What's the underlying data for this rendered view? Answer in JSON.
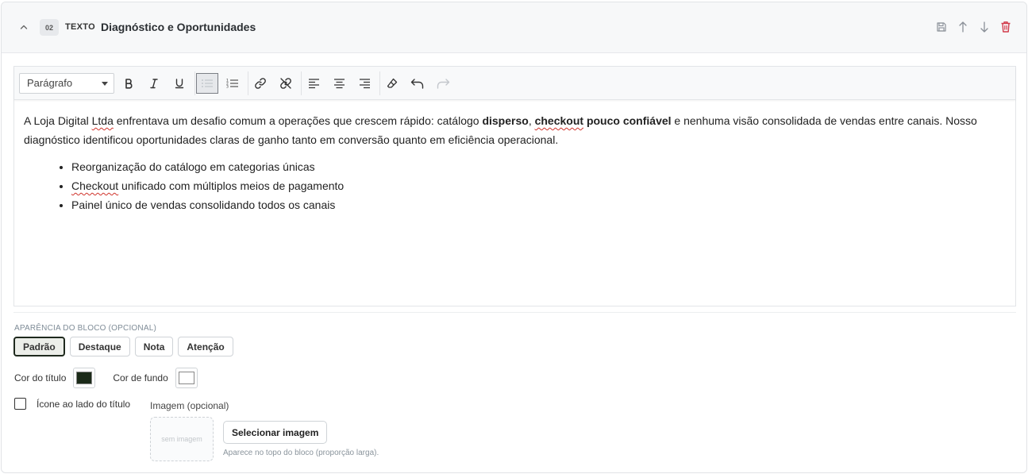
{
  "header": {
    "number": "02",
    "type": "TEXTO",
    "title": "Diagnóstico e Oportunidades"
  },
  "toolbar": {
    "format_value": "Parágrafo"
  },
  "content": {
    "p1_a": "A Loja Digital ",
    "p1_ltda": "Ltda",
    "p1_b": " enfrentava um desafio comum a operações que crescem rápido: catálogo ",
    "p1_bold1": "disperso",
    "p1_comma": ", ",
    "p1_bold2_spell": "checkout",
    "p1_bold2_rest": " pouco confiável",
    "p1_c": " e nenhuma visão consolidada de vendas entre canais. Nosso diagnóstico identificou oportunidades claras de ganho tanto em conversão quanto em eficiência operacional.",
    "li1": "Reorganização do catálogo em categorias únicas",
    "li2_spell": "Checkout",
    "li2_rest": " unificado com múltiplos meios de pagamento",
    "li3": "Painel único de vendas consolidando todos os canais"
  },
  "appearance": {
    "label": "APARÊNCIA DO BLOCO (OPCIONAL)",
    "options": [
      "Padrão",
      "Destaque",
      "Nota",
      "Atenção"
    ],
    "selected": "Padrão"
  },
  "colors": {
    "title_label": "Cor do título",
    "title_color": "#1b2a18",
    "bg_label": "Cor de fundo",
    "bg_color": "#ffffff"
  },
  "icon": {
    "label": "Ícone ao lado do título"
  },
  "image": {
    "label": "Imagem (opcional)",
    "placeholder": "sem imagem",
    "button": "Selecionar imagem",
    "hint": "Aparece no topo do bloco (proporção larga)."
  }
}
